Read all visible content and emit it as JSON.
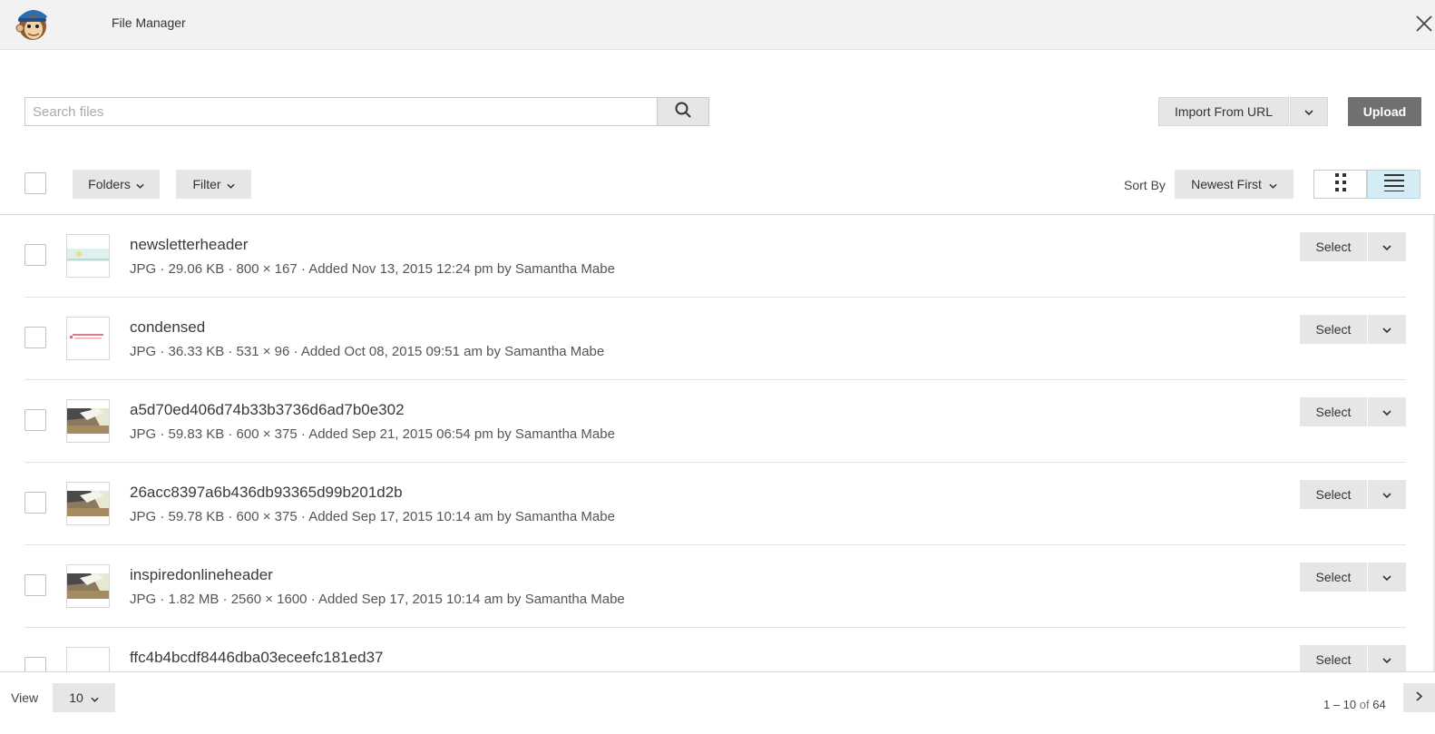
{
  "header": {
    "title": "File Manager",
    "logo_icon": "freddie-monkey-logo",
    "close_icon": "close-icon"
  },
  "search": {
    "placeholder": "Search files",
    "value": "",
    "icon": "search-icon"
  },
  "actions": {
    "import_label": "Import From URL",
    "upload_label": "Upload"
  },
  "toolbar": {
    "folders_label": "Folders",
    "filter_label": "Filter",
    "sort_by_label": "Sort By",
    "sort_value": "Newest First",
    "view_mode": "list"
  },
  "files": [
    {
      "name": "newsletterheader",
      "meta": "JPG · 29.06 KB · 800 × 167 · Added Nov 13, 2015 12:24 pm by Samantha Mabe",
      "select_label": "Select",
      "thumb": "banner-light"
    },
    {
      "name": "condensed",
      "meta": "JPG · 36.33 KB · 531 × 96 · Added Oct 08, 2015 09:51 am by Samantha Mabe",
      "select_label": "Select",
      "thumb": "text-pink"
    },
    {
      "name": "a5d70ed406d74b33b3736d6ad7b0e302",
      "meta": "JPG · 59.83 KB · 600 × 375 · Added Sep 21, 2015 06:54 pm by Samantha Mabe",
      "select_label": "Select",
      "thumb": "desk-photo"
    },
    {
      "name": "26acc8397a6b436db93365d99b201d2b",
      "meta": "JPG · 59.78 KB · 600 × 375 · Added Sep 17, 2015 10:14 am by Samantha Mabe",
      "select_label": "Select",
      "thumb": "desk-photo"
    },
    {
      "name": "inspiredonlineheader",
      "meta": "JPG · 1.82 MB · 2560 × 1600 · Added Sep 17, 2015 10:14 am by Samantha Mabe",
      "select_label": "Select",
      "thumb": "desk-photo"
    },
    {
      "name": "ffc4b4bcdf8446dba03eceefc181ed37",
      "meta": "",
      "select_label": "Select",
      "thumb": "faint-sketch"
    }
  ],
  "footer": {
    "view_label": "View",
    "per_page": "10",
    "range": "1 – 10",
    "of_label": "of",
    "total": "64"
  }
}
